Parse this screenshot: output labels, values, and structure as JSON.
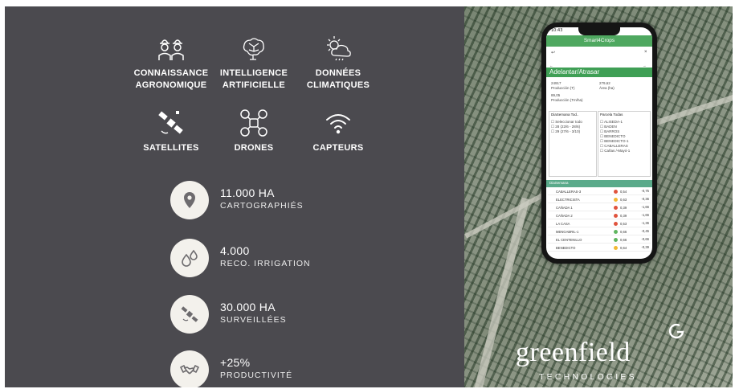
{
  "features": [
    {
      "icon": "farmers-icon",
      "label": "CONNAISSANCE\nAGRONOMIQUE"
    },
    {
      "icon": "brain-network-icon",
      "label": "INTELLIGENCE\nARTIFICIELLE"
    },
    {
      "icon": "sun-cloud-icon",
      "label": "DONNÉES\nCLIMATIQUES"
    },
    {
      "icon": "satellite-icon",
      "label": "SATELLITES"
    },
    {
      "icon": "drone-icon",
      "label": "DRONES"
    },
    {
      "icon": "wifi-sensor-icon",
      "label": "CAPTEURS"
    }
  ],
  "stats": [
    {
      "icon": "location-pin-icon",
      "value": "11.000 HA",
      "label": "CARTOGRAPHIÉS"
    },
    {
      "icon": "water-drops-icon",
      "value": "4.000",
      "label": "RECO. IRRIGATION"
    },
    {
      "icon": "satellite-icon",
      "value": "30.000 HA",
      "label": "SURVEILLÉES"
    },
    {
      "icon": "handshake-icon",
      "value": "+25%",
      "label": "PRODUCTIVITÉ"
    }
  ],
  "phone": {
    "status_time": "10:43",
    "app_title": "Smart4Crops",
    "section_title": "Adelantar/Atrasar",
    "metric_1_value": "24917",
    "metric_1_label": "Producción (T)",
    "metric_2_value": "279,62",
    "metric_2_label": "Área (ha)",
    "metric_3_value": "89,05",
    "metric_3_label": "Producción (Tm/ha)",
    "filter_1_title": "DiaSemana Tod..",
    "filter_1_items": [
      "Seleccionar todo",
      "28 (22/6 - 28/6)",
      "29 (27/6 - 3/10)"
    ],
    "filter_2_title": "Parcela Todas",
    "filter_2_items": [
      "ALISEDA-1",
      "BADEN",
      "BARROS",
      "BENEDICTO",
      "BENEDICTO-1",
      "CABALLERAS",
      "Cañas /-Mayó-1"
    ],
    "table_header": "DiaSemana",
    "rows": [
      {
        "name": "CABALLERAS-3",
        "status": "#e0533d",
        "v1": "0,54",
        "v2": "-0,75"
      },
      {
        "name": "ELECTRICISTA",
        "status": "#f2b833",
        "v1": "0,63",
        "v2": "-0,36"
      },
      {
        "name": "CAÑADA 1",
        "status": "#e0533d",
        "v1": "0,39",
        "v2": "-1,66"
      },
      {
        "name": "CAÑADA 2",
        "status": "#e0533d",
        "v1": "0,39",
        "v2": "-1,66"
      },
      {
        "name": "LA CASA",
        "status": "#e0533d",
        "v1": "0,53",
        "v2": "-1,36"
      },
      {
        "name": "MENGABRIL-1",
        "status": "#5fb55f",
        "v1": "0,66",
        "v2": "-0,45"
      },
      {
        "name": "EL CENTENILLO",
        "status": "#5fb55f",
        "v1": "0,66",
        "v2": "-0,66"
      },
      {
        "name": "BENEDICTO",
        "status": "#f2b833",
        "v1": "0,64",
        "v2": "-0,39"
      }
    ]
  },
  "brand": {
    "name": "greenfield",
    "tagline": "TECHNOLOGIES"
  }
}
